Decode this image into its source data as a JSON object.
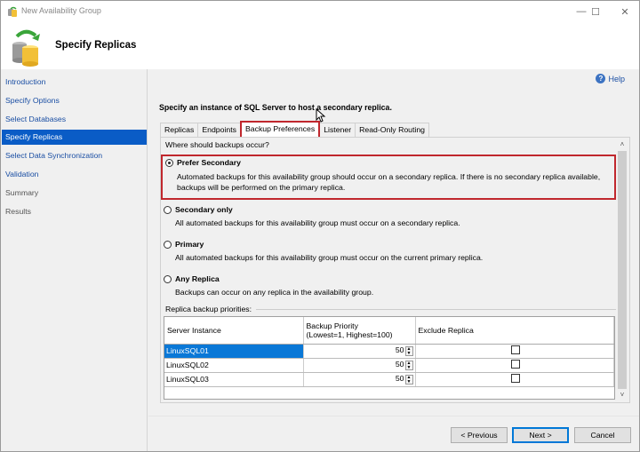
{
  "window": {
    "title": "New Availability Group",
    "controls": [
      "minimize",
      "maximize",
      "close"
    ]
  },
  "header": {
    "title": "Specify Replicas",
    "icon": "availability-group-databases-icon"
  },
  "sidebar": {
    "items": [
      {
        "label": "Introduction",
        "state": "link"
      },
      {
        "label": "Specify Options",
        "state": "link"
      },
      {
        "label": "Select Databases",
        "state": "link"
      },
      {
        "label": "Specify Replicas",
        "state": "active"
      },
      {
        "label": "Select Data Synchronization",
        "state": "link"
      },
      {
        "label": "Validation",
        "state": "link"
      },
      {
        "label": "Summary",
        "state": "disabled"
      },
      {
        "label": "Results",
        "state": "disabled"
      }
    ]
  },
  "main": {
    "help_label": "Help",
    "instruction": "Specify an instance of SQL Server to host a secondary replica.",
    "tabs": [
      {
        "label": "Replicas"
      },
      {
        "label": "Endpoints"
      },
      {
        "label": "Backup Preferences",
        "active": true
      },
      {
        "label": "Listener"
      },
      {
        "label": "Read-Only Routing"
      }
    ],
    "backup": {
      "question": "Where should backups occur?",
      "options": [
        {
          "label": "Prefer Secondary",
          "desc": "Automated backups for this availability group should occur on a secondary replica. If there is no secondary replica available, backups will be performed on the primary replica.",
          "checked": true
        },
        {
          "label": "Secondary only",
          "desc": "All automated backups for this availability group must occur on a secondary replica.",
          "checked": false
        },
        {
          "label": "Primary",
          "desc": "All automated backups for this availability group must occur on the current primary replica.",
          "checked": false
        },
        {
          "label": "Any Replica",
          "desc": "Backups can occur on any replica in the availability group.",
          "checked": false
        }
      ],
      "priorities_label": "Replica backup priorities:",
      "columns": [
        "Server Instance",
        "Backup Priority\n(Lowest=1, Highest=100)",
        "Exclude Replica"
      ],
      "col_priority_line1": "Backup Priority",
      "col_priority_line2": "(Lowest=1, Highest=100)",
      "rows": [
        {
          "server": "LinuxSQL01",
          "priority": "50",
          "exclude": false,
          "selected": true
        },
        {
          "server": "LinuxSQL02",
          "priority": "50",
          "exclude": false,
          "selected": false
        },
        {
          "server": "LinuxSQL03",
          "priority": "50",
          "exclude": false,
          "selected": false
        }
      ]
    }
  },
  "footer": {
    "previous": "< Previous",
    "next": "Next >",
    "cancel": "Cancel"
  },
  "colors": {
    "highlight_border": "#c0272d",
    "nav_active": "#0a5cc6",
    "link": "#1a4ea3",
    "row_selected": "#0a78d7"
  }
}
